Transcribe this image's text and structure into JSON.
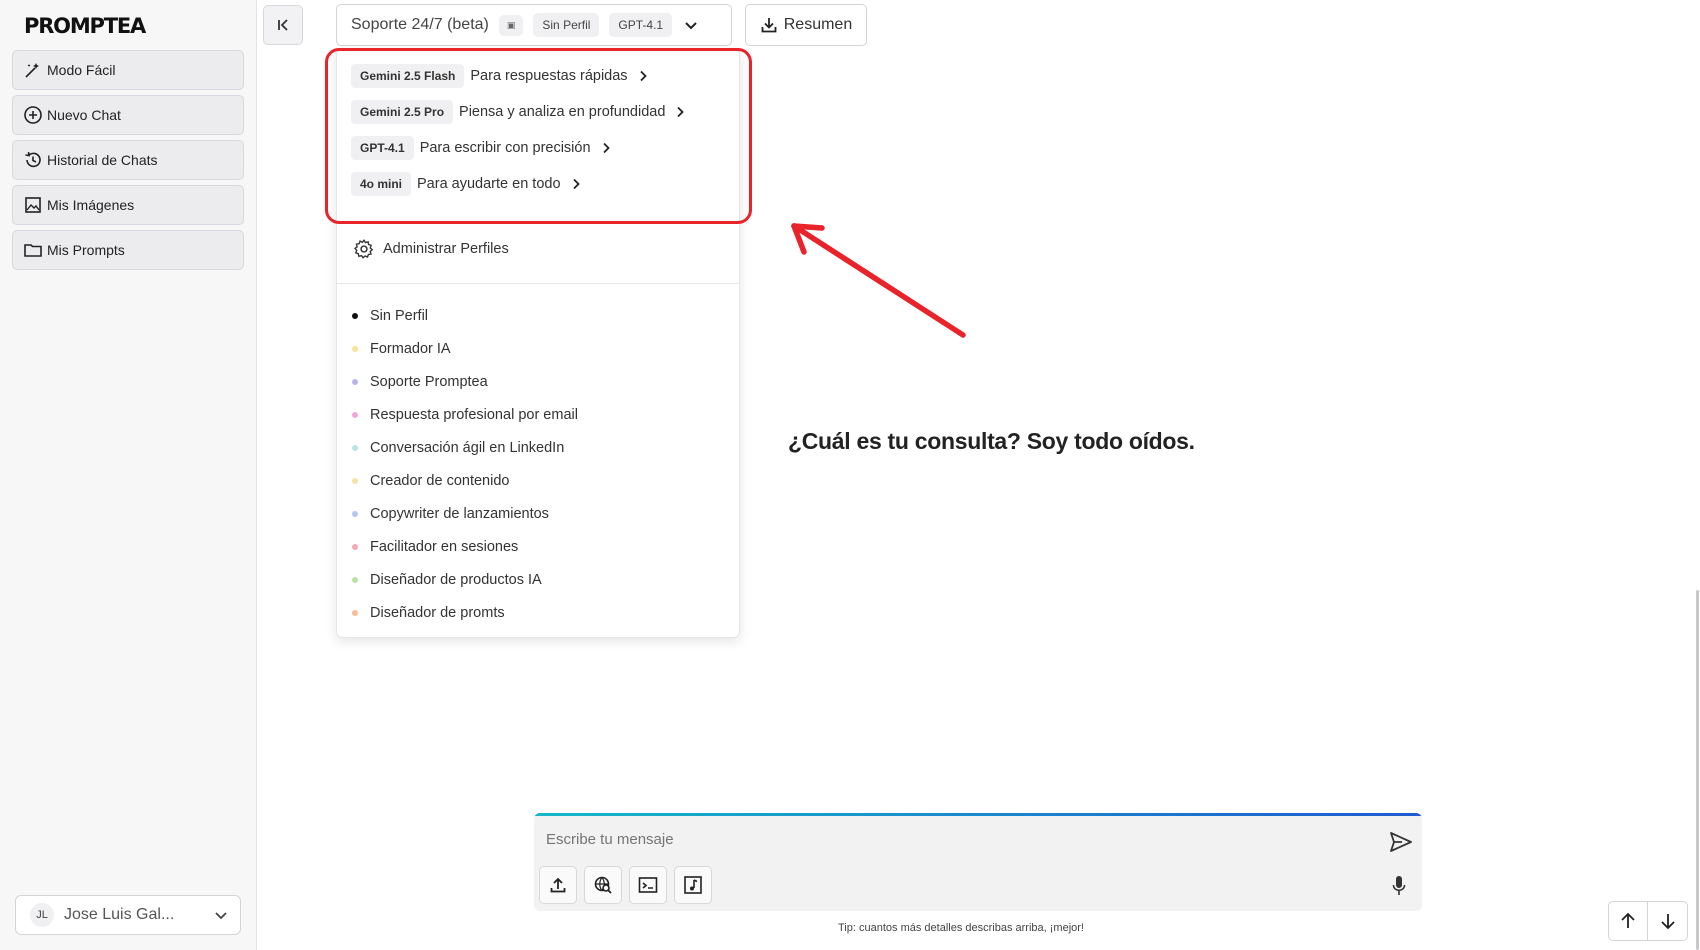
{
  "app": {
    "logo": "PROMPTEA"
  },
  "sidebar": {
    "items": [
      {
        "label": "Modo Fácil",
        "icon": "magic-wand-icon"
      },
      {
        "label": "Nuevo Chat",
        "icon": "plus-circle-icon"
      },
      {
        "label": "Historial de Chats",
        "icon": "history-icon"
      },
      {
        "label": "Mis Imágenes",
        "icon": "image-icon"
      },
      {
        "label": "Mis Prompts",
        "icon": "folder-icon"
      }
    ],
    "user": {
      "initials": "JL",
      "name": "Jose Luis Gal..."
    }
  },
  "header": {
    "assistant_title": "Soporte 24/7 (beta)",
    "profile_chip": "Sin Perfil",
    "model_chip": "GPT-4.1",
    "summary_label": "Resumen"
  },
  "dropdown": {
    "models": [
      {
        "name": "Gemini 2.5 Flash",
        "desc": "Para respuestas rápidas"
      },
      {
        "name": "Gemini 2.5 Pro",
        "desc": "Piensa y analiza en profundidad"
      },
      {
        "name": "GPT-4.1",
        "desc": "Para escribir con precisión"
      },
      {
        "name": "4o mini",
        "desc": "Para ayudarte en todo"
      }
    ],
    "admin_label": "Administrar Perfiles",
    "profiles": [
      {
        "label": "Sin Perfil",
        "color": "#111111"
      },
      {
        "label": "Formador IA",
        "color": "#f7e39a"
      },
      {
        "label": "Soporte Promptea",
        "color": "#b9b4ec"
      },
      {
        "label": "Respuesta profesional por email",
        "color": "#f0a8d8"
      },
      {
        "label": "Conversación ágil en LinkedIn",
        "color": "#b6e6de"
      },
      {
        "label": "Creador de contenido",
        "color": "#f6e2a8"
      },
      {
        "label": "Copywriter de lanzamientos",
        "color": "#b5c8ee"
      },
      {
        "label": "Facilitador en sesiones",
        "color": "#f4a9b4"
      },
      {
        "label": "Diseñador de productos IA",
        "color": "#b8e4a2"
      },
      {
        "label": "Diseñador de promts",
        "color": "#f7be96"
      }
    ]
  },
  "main": {
    "prompt": "¿Cuál es tu consulta? Soy todo oídos."
  },
  "chat": {
    "placeholder": "Escribe tu mensaje",
    "tip": "Tip: cuantos más detalles describas arriba, ¡mejor!"
  },
  "colors": {
    "highlight": "#e8232a",
    "accent_start": "#15b8c9",
    "accent_end": "#1f5bd1"
  }
}
